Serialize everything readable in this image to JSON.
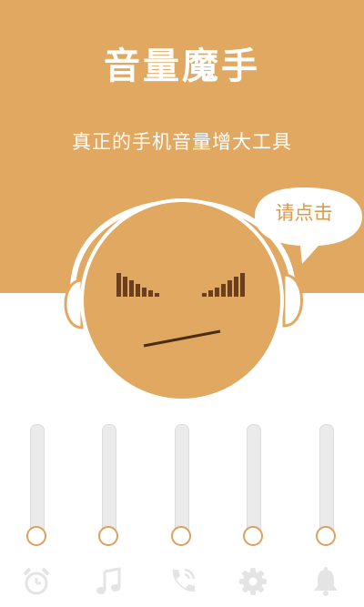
{
  "app": {
    "title": "音量魔手",
    "subtitle": "真正的手机音量增大工具",
    "bubble_text": "请点击"
  },
  "colors": {
    "brand": "#e0a860",
    "face": "#e0a860",
    "outline": "#ffffff",
    "eq_bars": "#6b3f1e",
    "slider_knob": "#dca060",
    "tab_icon": "#e4e4e4"
  },
  "sliders": [
    {
      "name": "alarm",
      "level": 0
    },
    {
      "name": "music",
      "level": 0
    },
    {
      "name": "call",
      "level": 0
    },
    {
      "name": "system",
      "level": 0
    },
    {
      "name": "ringtone",
      "level": 0
    }
  ],
  "tabs": [
    {
      "icon": "alarm-clock-icon"
    },
    {
      "icon": "music-note-icon"
    },
    {
      "icon": "phone-icon"
    },
    {
      "icon": "gear-icon"
    },
    {
      "icon": "bell-icon"
    }
  ]
}
